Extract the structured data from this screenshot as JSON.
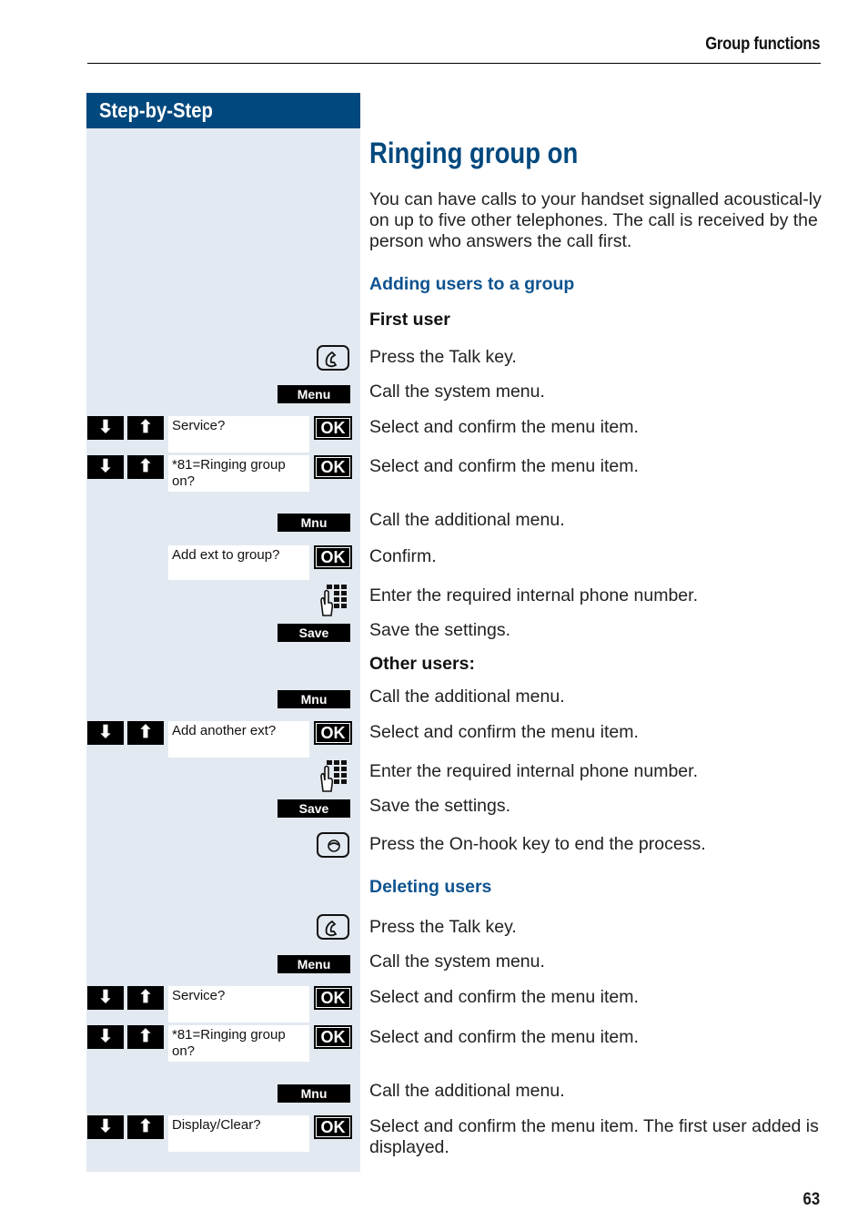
{
  "header": {
    "section_title": "Group functions"
  },
  "sidebar": {
    "title": "Step-by-Step"
  },
  "page": {
    "title": "Ringing group on",
    "intro": "You can have calls to your handset signalled acoustical-ly on up to five other telephones. The call is received by the person who answers the call first.",
    "page_number": "63"
  },
  "sections": {
    "adding": {
      "heading": "Adding users to a group",
      "first_user_label": "First user",
      "other_users_label": "Other users:"
    },
    "deleting": {
      "heading": "Deleting users"
    }
  },
  "keys": {
    "menu": "Menu",
    "mnu": "Mnu",
    "save": "Save",
    "ok": "OK",
    "down_arrow": "⬇",
    "up_arrow": "⬆"
  },
  "displays": {
    "service": "Service?",
    "ringing_group": "*81=Ringing group on?",
    "add_ext": "Add ext to group?",
    "add_another": "Add another ext?",
    "display_clear": "Display/Clear?"
  },
  "steps": {
    "talk1": "Press the Talk key.",
    "menu1": "Call the system menu.",
    "service1": "Select and confirm the menu item.",
    "ringing1": "Select and confirm the menu item.",
    "mnu1": "Call the additional menu.",
    "confirm1": "Confirm.",
    "enter1": "Enter the required internal phone number.",
    "save1": "Save the settings.",
    "mnu2": "Call the additional menu.",
    "another": "Select and confirm the menu item.",
    "enter2": "Enter the required internal phone number.",
    "save2": "Save the settings.",
    "onhook": "Press the On-hook key to end the process.",
    "talk2": "Press the Talk key.",
    "menu2": "Call the system menu.",
    "service2": "Select and confirm the menu item.",
    "ringing2": "Select and confirm the menu item.",
    "mnu3": "Call the additional menu.",
    "displayclear": "Select and confirm the menu item. The first user added is displayed."
  }
}
